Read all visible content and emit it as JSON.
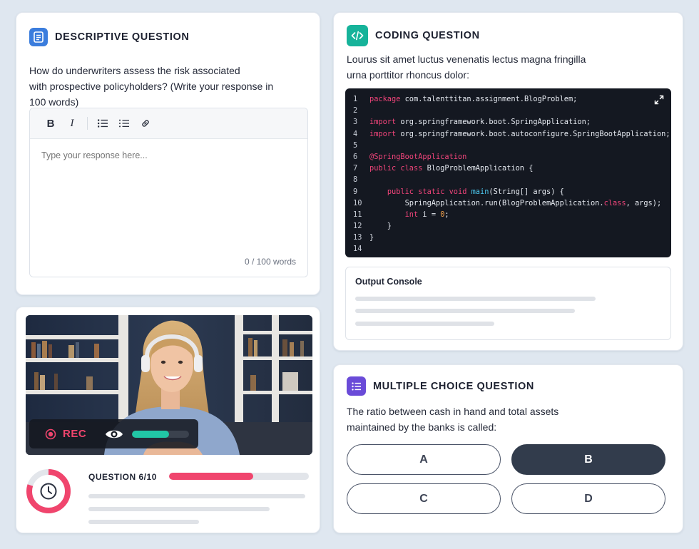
{
  "descriptive": {
    "title": "DESCRIPTIVE QUESTION",
    "prompt_line1": "How do underwriters assess the risk associated",
    "prompt_line2": "with prospective policyholders? (Write your response in",
    "prompt_line3": "100 words)",
    "toolbar": {
      "bold": "B",
      "italic": "I"
    },
    "placeholder": "Type your response here...",
    "word_count": "0 / 100 words",
    "accent_color": "#3b7ddd"
  },
  "coding": {
    "title": "CODING QUESTION",
    "prompt_line1": "Lourus sit amet luctus venenatis lectus magna fringilla",
    "prompt_line2": "urna porttitor rhoncus dolor:",
    "accent_color": "#16b39a",
    "lines": [
      {
        "n": "1"
      },
      {
        "n": "2"
      },
      {
        "n": "3"
      },
      {
        "n": "4"
      },
      {
        "n": "5"
      },
      {
        "n": "6"
      },
      {
        "n": "7"
      },
      {
        "n": "8"
      },
      {
        "n": "9"
      },
      {
        "n": "10"
      },
      {
        "n": "11"
      },
      {
        "n": "12"
      },
      {
        "n": "13"
      },
      {
        "n": "14"
      }
    ],
    "code": {
      "l1_kw": "package",
      "l1_rest": " com.talenttitan.assignment.BlogProblem;",
      "l3_kw": "import",
      "l3_rest": " org.springframework.boot.SpringApplication;",
      "l4_kw": "import",
      "l4_rest": " org.springframework.boot.autoconfigure.SpringBootApplication;",
      "l6_ann": "@SpringBootApplication",
      "l7_kw": "public class",
      "l7_rest": " BlogProblemApplication {",
      "l9_indent": "    ",
      "l9_kw": "public static void",
      "l9_fn": " main",
      "l9_rest": "(String[] args) {",
      "l10_rest": "        SpringApplication.run(BlogProblemApplication.",
      "l10_kw": "class",
      "l10_rest2": ", args);",
      "l11_indent": "        ",
      "l11_kw": "int",
      "l11_rest": " i = ",
      "l11_num": "0",
      "l11_end": ";",
      "l12_rest": "    }",
      "l13_rest": "}"
    },
    "console_title": "Output Console"
  },
  "video": {
    "rec_label": "REC",
    "audio_level": 0.65,
    "question_label": "QUESTION 6/10",
    "question_progress": 0.6,
    "timer_remaining": 0.8,
    "rec_color": "#f0456d",
    "level_color": "#21c7a6"
  },
  "mcq": {
    "title": "MULTIPLE CHOICE QUESTION",
    "prompt_line1": "The ratio between cash in hand and total assets",
    "prompt_line2": "maintained by the banks is called:",
    "accent_color": "#6a4bd8",
    "options": [
      {
        "label": "A",
        "selected": false
      },
      {
        "label": "B",
        "selected": true
      },
      {
        "label": "C",
        "selected": false
      },
      {
        "label": "D",
        "selected": false
      }
    ]
  }
}
